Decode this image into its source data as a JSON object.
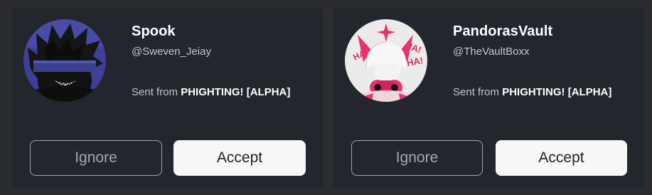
{
  "requests": [
    {
      "display_name": "Spook",
      "username": "@Sweven_Jeiay",
      "sent_prefix": "Sent from ",
      "game": "PHIGHTING! [ALPHA]",
      "ignore_label": "Ignore",
      "accept_label": "Accept"
    },
    {
      "display_name": "PandorasVault",
      "username": "@TheVaultBoxx",
      "sent_prefix": "Sent from ",
      "game": "PHIGHTING! [ALPHA]",
      "ignore_label": "Ignore",
      "accept_label": "Accept"
    }
  ],
  "avatar_decor_text": [
    "HA!",
    "HA!",
    "HA!"
  ],
  "colors": {
    "page_bg": "#2b2c2f",
    "card_bg": "#23262d",
    "accept_bg": "#f7f7f8",
    "ignore_border": "#a4a8b0",
    "avatar_accent_pink": "#e8326e",
    "avatar_accent_blue": "#3f3f9e"
  }
}
